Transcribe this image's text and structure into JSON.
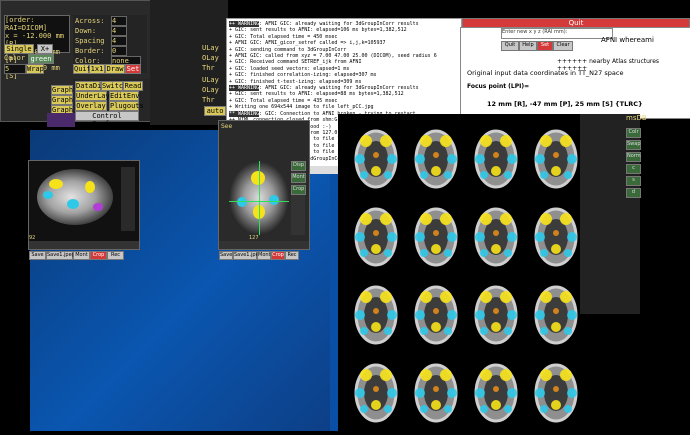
{
  "afni_main": {
    "order_label": "[order: RAI=DICOM]",
    "coords": [
      "x = -12.000 mm [R]",
      "y = 47.000 mm [P]",
      "z = 25.000 mm [S]"
    ],
    "single_label": "Single",
    "x_label": "X+",
    "color_label": "Color",
    "color_value": "green",
    "num_value": "5",
    "wrap_label": "Wrap",
    "graph_label": "Graph",
    "montage": {
      "across_label": "Across:",
      "across_value": "4",
      "down_label": "Down:",
      "down_value": "4",
      "spacing_label": "Spacing",
      "spacing_value": "4",
      "border_label": "Border:",
      "border_value": "0",
      "color_label": "Color:",
      "color_value": "none"
    },
    "mbtns": [
      "Quit",
      "1x1",
      "Draw",
      "Set"
    ],
    "uq": [
      "ULay",
      "OLay",
      "Thr"
    ],
    "ctrl": {
      "datadir": "DataDir",
      "switch": "Switch",
      "read": "Read",
      "underlay": "UnderLay",
      "editenv": "EditEnv",
      "overlay": "Overlay",
      "plugouts": "Plugouts",
      "control_surface": "Control Surface"
    },
    "ulay_labels": [
      "ULay",
      "OLay",
      "Thr"
    ],
    "auto_label": "auto",
    "see_label": "See"
  },
  "terminal": {
    "lines": [
      "++ WARNING: AFNI GIC: already waiting for 3dGroupInCorr results",
      " + GIC: sent results to AFNI: elapsed=106 ms  bytes=1,382,512",
      " + GIC: Total elapsed time = 450 msec",
      " + AFNI GIC: AFNI_gicor_setref called => i,j,k=105937",
      " + GIC: sending command to 3dGroupInCorr",
      " + AFNI GIC: called from xyz = 7.00 47.00 25.00 (DICOM), seed radius 6",
      " + GIC: Received command SETREF_ijk from AFNI",
      " + GIC: loaded seed vectors: elapsed=1 ms",
      " + GIC: finished correlation-izing: elapsed=307 ms",
      " + GIC: finished t-test-izing: elapsed=309 ms",
      "++ WARNING: AFNI GIC: already waiting for 3dGroupInCorr results",
      " + GIC: sent results to AFNI: elapsed=88 ms  bytes=1,382,512",
      " + GIC: Total elapsed time = 435 msec",
      " + Writing one 694x544 image to file left_pCC.jpg",
      "** WARNING: GIC: Connection to AFNI broken - trying to restart",
      "++ NIML connection closed from shm:GrpInCorr_53213:1M+4K (shm:GrpInCorr_53213:1M+4K,IRIX)",
      "++ GIC: TCP/IP restart is good :-)",
      "++ NIML connection opened from 127.0.0.1 (tcp:host:53213,AFNI_GroupInCorr_NIML)",
      " + Writing one 694x544 image to file left_pCC.jpg",
      " + Writing one 694x544 image to file left_pCC_xxCross.jpg",
      " + Writing one 694x544 image to file left_pCC_xxCrossb.jpg",
      " + AFNI GIC: connection to 3dGroupInCorr is broken"
    ]
  },
  "whereami": {
    "top_title": "Quit",
    "input_placeholder": "Enter new x y z (RAI mm):",
    "buttons": [
      "Quit",
      "Help",
      "Set",
      "Clear"
    ],
    "title": "AFNI whereami",
    "nearby": "++++++ nearby Atlas structures ++++++",
    "space": "Original input data coordinates in TT_N27 space",
    "focus": "Focus point (LPI)=",
    "coords": "12 mm [R], -47 mm [P], 25 mm [S] {TLRC}",
    "db_label": "msDB"
  },
  "sag_window": {
    "slice_num": "92",
    "bottom_btns": [
      "Save",
      "Save1.jpeg",
      "Mont",
      "Crop",
      "Rec"
    ]
  },
  "mid_window": {
    "slice_num": "127",
    "bottom_btns": [
      "Save",
      "Save1.jpeg",
      "Mont",
      "Crop",
      "Rec"
    ]
  },
  "montage_side": [
    "Colr",
    "Swap",
    "Norm",
    "c",
    "s",
    "d"
  ],
  "right_side": [
    "Disp",
    "Mont",
    "Crop"
  ],
  "colors": {
    "desktop": "#0a56b0",
    "afni_yellow": "#e6d67a",
    "warn": "#333333",
    "red": "#d43a3a"
  }
}
